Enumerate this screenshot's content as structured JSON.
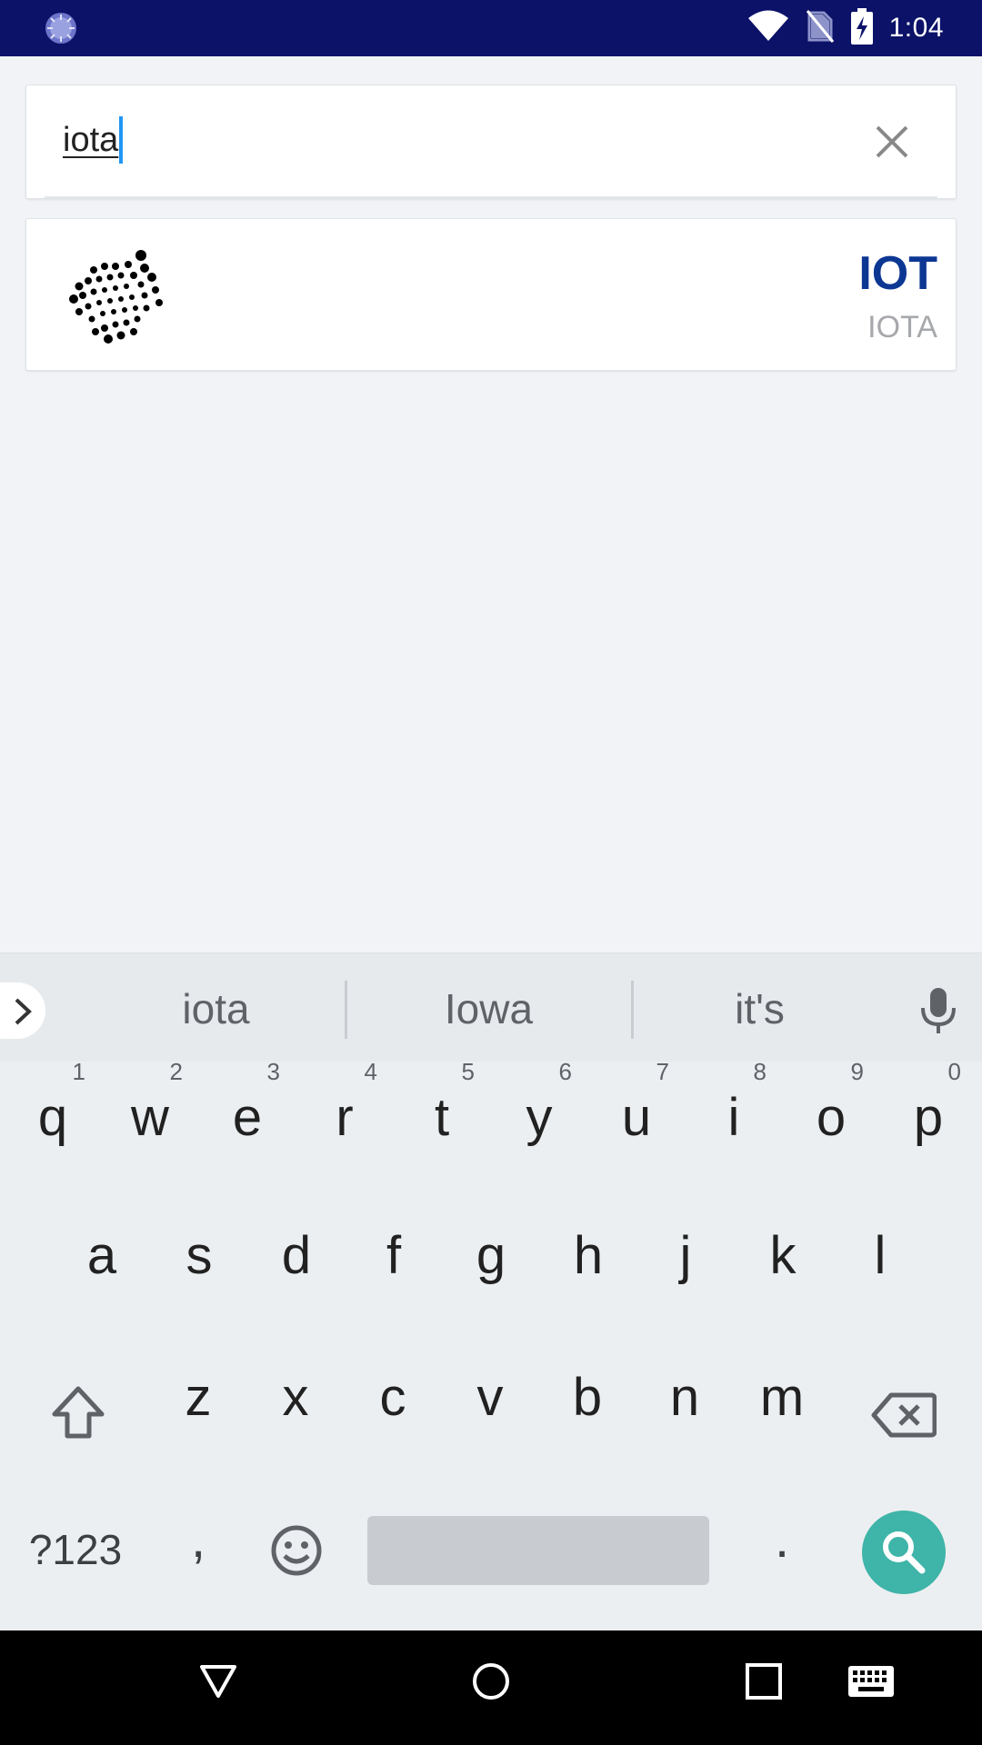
{
  "status_bar": {
    "time": "1:04",
    "icons": [
      "loading-icon",
      "wifi-icon",
      "no-sim-icon",
      "battery-charging-icon"
    ]
  },
  "search": {
    "value": "iota",
    "clear_icon": "close-icon"
  },
  "results": [
    {
      "symbol": "IOT",
      "name": "IOTA",
      "logo_icon": "iota-logo"
    }
  ],
  "keyboard": {
    "suggestions": [
      "iota",
      "Iowa",
      "it's"
    ],
    "row1": [
      {
        "key": "q",
        "num": "1"
      },
      {
        "key": "w",
        "num": "2"
      },
      {
        "key": "e",
        "num": "3"
      },
      {
        "key": "r",
        "num": "4"
      },
      {
        "key": "t",
        "num": "5"
      },
      {
        "key": "y",
        "num": "6"
      },
      {
        "key": "u",
        "num": "7"
      },
      {
        "key": "i",
        "num": "8"
      },
      {
        "key": "o",
        "num": "9"
      },
      {
        "key": "p",
        "num": "0"
      }
    ],
    "row2": [
      "a",
      "s",
      "d",
      "f",
      "g",
      "h",
      "j",
      "k",
      "l"
    ],
    "row3": [
      "z",
      "x",
      "c",
      "v",
      "b",
      "n",
      "m"
    ],
    "symbols_label": "?123",
    "comma_label": ",",
    "period_label": ".",
    "accent_color": "#3fb4a8"
  },
  "colors": {
    "status_bar": "#0b1268",
    "symbol_text": "#0c3793",
    "cursor": "#2196f3"
  }
}
